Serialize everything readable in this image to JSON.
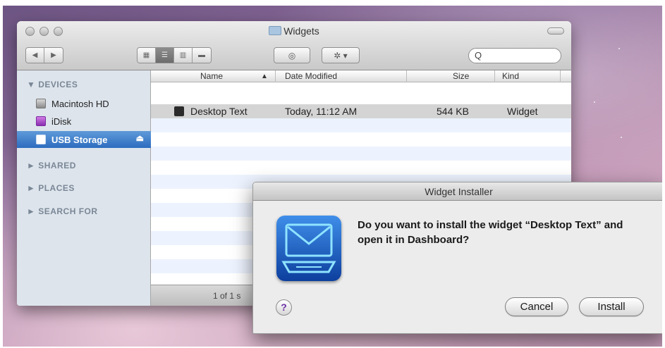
{
  "finder": {
    "title": "Widgets",
    "search_glyph": "Q",
    "sidebar": {
      "devices_header": "▼ DEVICES",
      "devices": [
        {
          "label": "Macintosh HD"
        },
        {
          "label": "iDisk"
        },
        {
          "label": "USB Storage",
          "selected": true
        }
      ],
      "sections": [
        "► SHARED",
        "► PLACES",
        "► SEARCH FOR"
      ]
    },
    "columns": {
      "name": "Name",
      "sort_glyph": "▲",
      "date": "Date Modified",
      "size": "Size",
      "kind": "Kind"
    },
    "rows": [
      {
        "name": "Desktop Text",
        "date": "Today, 11:12 AM",
        "size": "544 KB",
        "kind": "Widget"
      }
    ],
    "status": "1 of 1 s"
  },
  "dialog": {
    "title": "Widget Installer",
    "message": "Do you want to install the widget “Desktop Text” and open it in Dashboard?",
    "help_label": "?",
    "cancel_label": "Cancel",
    "install_label": "Install"
  },
  "colors": {
    "selection_blue": "#2c6cbf",
    "row_stripe": "#edf3fe",
    "help_purple": "#6a2fa5"
  },
  "icons": [
    "folder-icon",
    "back-arrow-icon",
    "forward-arrow-icon",
    "icon-view-icon",
    "list-view-icon",
    "column-view-icon",
    "coverflow-view-icon",
    "quicklook-eye-icon",
    "gear-icon",
    "search-icon",
    "hard-drive-icon",
    "idisk-icon",
    "usb-drive-icon",
    "eject-icon",
    "widget-icon",
    "mail-widget-icon"
  ]
}
